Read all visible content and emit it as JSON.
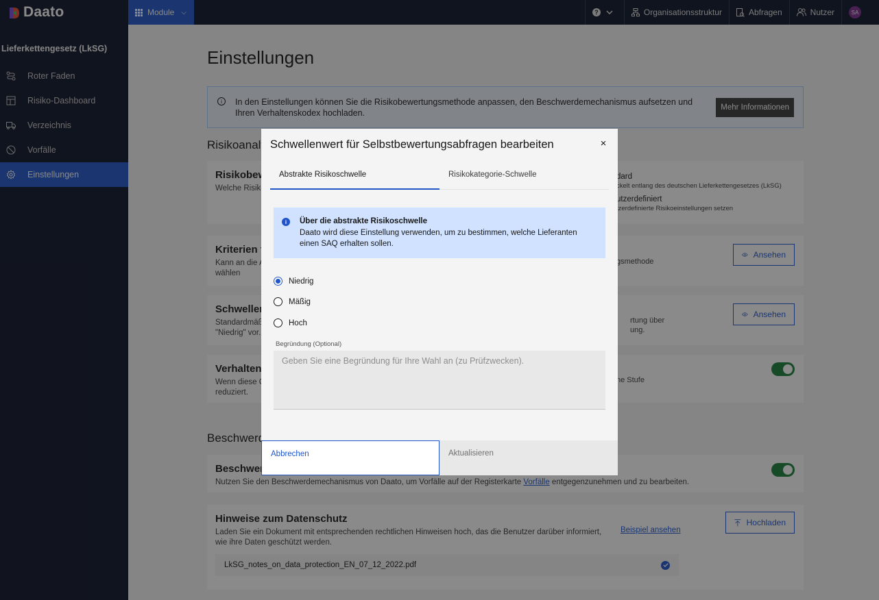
{
  "topbar": {
    "logo_text": "Daato",
    "module_label": "Module",
    "help_icon": "?",
    "items": [
      {
        "label": "Organisationsstruktur",
        "icon": "org-structure-icon"
      },
      {
        "label": "Abfragen",
        "icon": "queries-icon"
      },
      {
        "label": "Nutzer",
        "icon": "users-icon"
      }
    ],
    "avatar_initials": "SA"
  },
  "sidebar": {
    "title": "Lieferkettengesetz (LkSG)",
    "items": [
      {
        "label": "Roter Faden",
        "icon": "flow-icon"
      },
      {
        "label": "Risiko-Dashboard",
        "icon": "dashboard-icon"
      },
      {
        "label": "Verzeichnis",
        "icon": "truck-icon"
      },
      {
        "label": "Vorfälle",
        "icon": "incident-icon"
      },
      {
        "label": "Einstellungen",
        "icon": "settings-icon",
        "active": true
      }
    ]
  },
  "page": {
    "title": "Einstellungen",
    "info_text": "In den Einstellungen können Sie die Risikobewertungsmethode anpassen, den Beschwerdemechanismus aufsetzen und Ihren Verhaltenskodex hochladen.",
    "info_button": "Mehr Informationen",
    "section1": "Risikoanaly",
    "card1": {
      "title": "Risikobew",
      "desc": "Welche Risiko",
      "opt1_title": "dard",
      "opt1_desc": "ckelt entlang des deutschen Lieferkettengesetzes (LkSG)",
      "opt2_title": "utzerdefiniert",
      "opt2_desc": "tzerdefinierte Risikoeinstellungen setzen"
    },
    "card2": {
      "title": "Kriterien f",
      "desc1": "Kann an die A",
      "desc2": "wählen",
      "side": "gsmethode",
      "button": "Ansehen"
    },
    "card3": {
      "title": "Schwellen",
      "desc1": "Standardmäß",
      "desc2": "\"Niedrig\" vor.",
      "side1": "rtung über",
      "side2": "ung.",
      "button": "Ansehen"
    },
    "card4": {
      "title": "Verhaltens",
      "desc1": "Wenn diese C",
      "desc2": "reduziert.",
      "side": "ne Stufe"
    },
    "section2": "Beschwerd",
    "card5": {
      "title": "Beschwer",
      "desc_pre": "Nutzen Sie den Beschwerdemechanismus von Daato, um Vorfälle auf der Registerkarte ",
      "desc_link": "Vorfälle",
      "desc_post": " entgegenzunehmen und zu bearbeiten."
    },
    "card6": {
      "title": "Hinweise zum Datenschutz",
      "desc": "Laden Sie ein Dokument mit entsprechenden rechtlichen Hinweisen hoch, das die Benutzer darüber informiert, wie ihre Daten geschützt werden.",
      "example_link": "Beispiel ansehen",
      "button": "Hochladen",
      "file": "LkSG_notes_on_data_protection_EN_07_12_2022.pdf"
    }
  },
  "modal": {
    "title": "Schwellenwert für Selbstbewertungsabfragen bearbeiten",
    "close": "×",
    "tabs": [
      "Abstrakte Risikoschwelle",
      "Risikokategorie-Schwelle"
    ],
    "notice_title": "Über die abstrakte Risikoschwelle",
    "notice_desc": "Daato wird diese Einstellung verwenden, um zu bestimmen, welche Lieferanten einen SAQ erhalten sollen.",
    "options": [
      {
        "label": "Niedrig",
        "checked": true
      },
      {
        "label": "Mäßig",
        "checked": false
      },
      {
        "label": "Hoch",
        "checked": false
      }
    ],
    "reason_label": "Begründung (Optional)",
    "reason_placeholder": "Geben Sie eine Begründung für Ihre Wahl an (zu Prüfzwecken).",
    "cancel": "Abbrechen",
    "update": "Aktualisieren"
  },
  "colors": {
    "primary": "#1f55c9",
    "nav": "#0b1226",
    "success": "#198038"
  }
}
